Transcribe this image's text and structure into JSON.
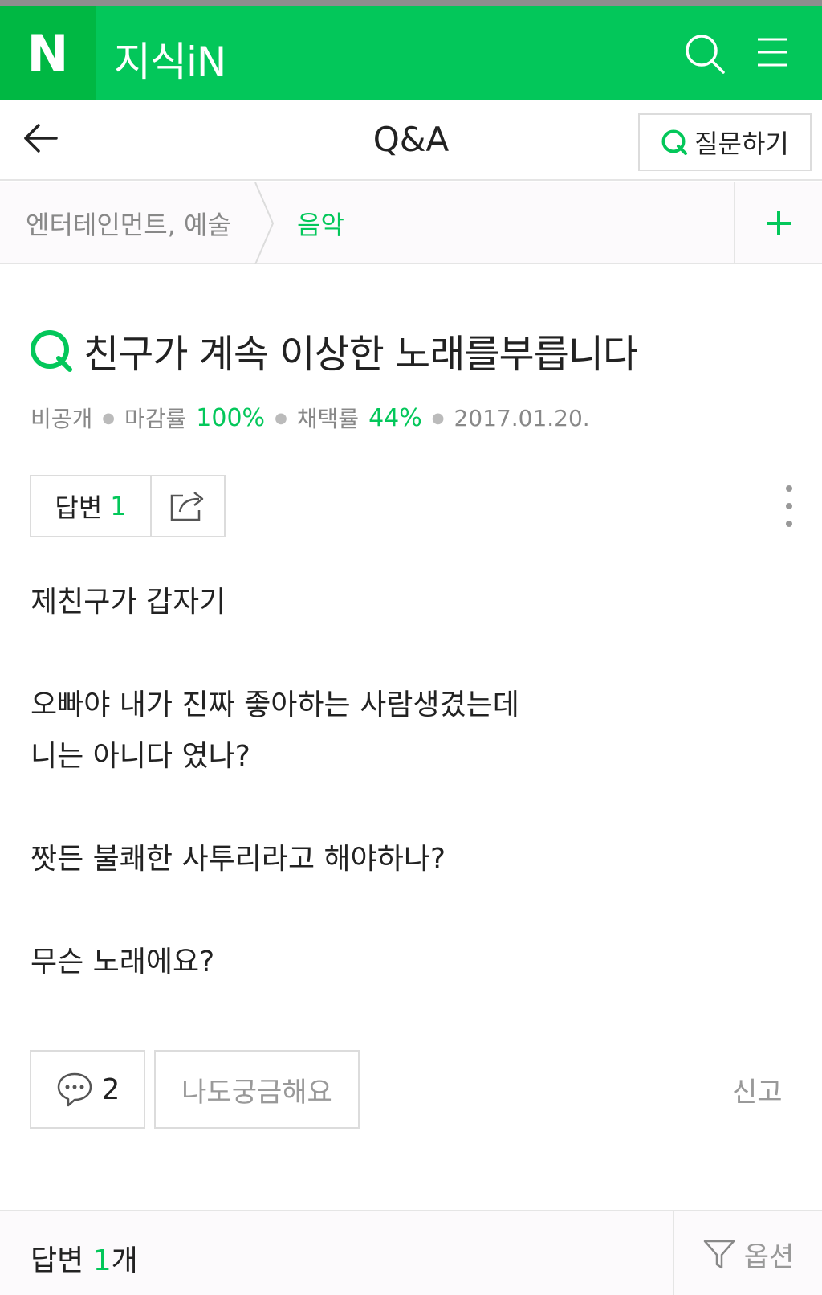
{
  "header": {
    "logo": "N",
    "service_name": "지식iN",
    "icons": [
      "search-icon",
      "menu-icon"
    ],
    "brand_color": "#03c75a"
  },
  "topbar": {
    "title": "Q&A",
    "ask_button": "질문하기"
  },
  "breadcrumb": {
    "parent": "엔터테인먼트, 예술",
    "current": "음악"
  },
  "question": {
    "title": "친구가 계속 이상한 노래를부릅니다",
    "meta": {
      "author": "비공개",
      "close_rate_label": "마감률",
      "close_rate": "100%",
      "adopt_rate_label": "채택률",
      "adopt_rate": "44%",
      "date": "2017.01.20."
    },
    "answer_button_label": "답변",
    "answer_count": "1",
    "body": [
      "제친구가 갑자기",
      "",
      "오빠야 내가 진짜 좋아하는 사람생겼는데",
      "니는 아니다 였나?",
      "",
      "짯든 불쾌한 사투리라고 해야하나?",
      "",
      "무슨 노래에요?"
    ],
    "comment_count": "2",
    "curious_button": "나도궁금해요",
    "report_link": "신고"
  },
  "answers_section": {
    "title": "답변",
    "count": "1",
    "unit": "개",
    "options_label": "옵션"
  }
}
